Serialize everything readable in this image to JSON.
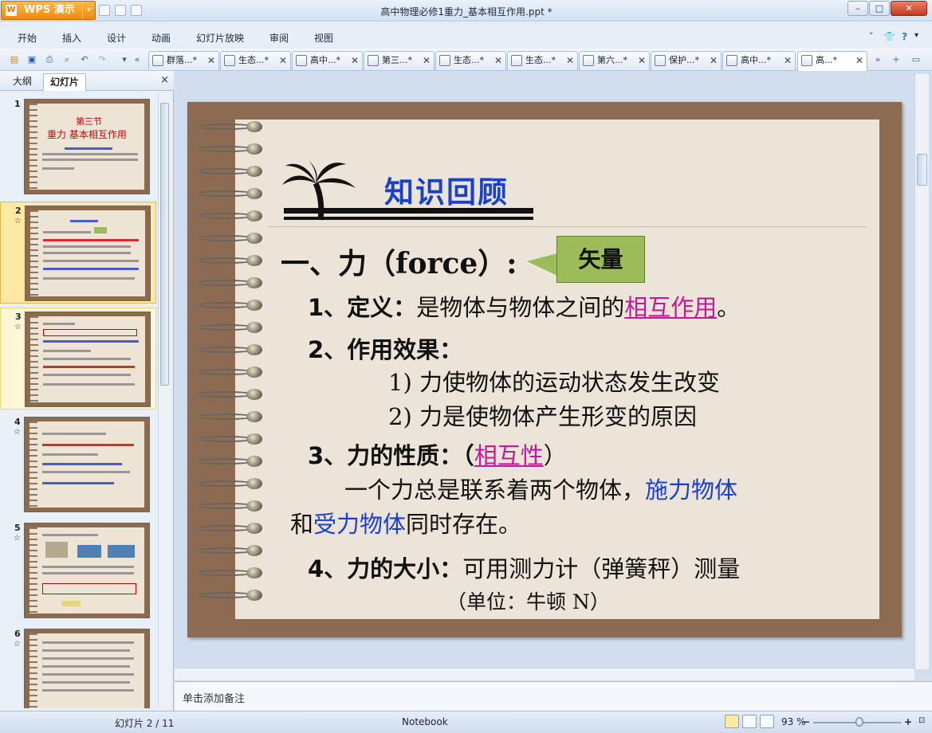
{
  "app": {
    "brand": "WPS 演示",
    "title": "高中物理必修1重力_基本相互作用.ppt *"
  },
  "menu": [
    "开始",
    "插入",
    "设计",
    "动画",
    "幻灯片放映",
    "审阅",
    "视图"
  ],
  "doc_tabs": [
    {
      "label": "群落...*"
    },
    {
      "label": "生态...*"
    },
    {
      "label": "高中...*"
    },
    {
      "label": "第三...*"
    },
    {
      "label": "生态...*"
    },
    {
      "label": "生态...*"
    },
    {
      "label": "第六...*"
    },
    {
      "label": "保护...*"
    },
    {
      "label": "高中...*"
    },
    {
      "label": "高...*"
    }
  ],
  "left_panel": {
    "tab_outline": "大纲",
    "tab_slides": "幻灯片",
    "close": "×"
  },
  "thumbnails": [
    {
      "num": "1",
      "star": ""
    },
    {
      "num": "2",
      "star": "☆"
    },
    {
      "num": "3",
      "star": "☆"
    },
    {
      "num": "4",
      "star": "☆"
    },
    {
      "num": "5",
      "star": "☆"
    },
    {
      "num": "6",
      "star": "☆"
    }
  ],
  "thumb1": {
    "line1": "第三节",
    "line2": "重力 基本相互作用"
  },
  "slide": {
    "heading": "知识回顾",
    "section1": "一、力（force）:",
    "callout": "矢量",
    "def_label": "1、定义：",
    "def_text": "是物体与物体之间的",
    "def_highlight": "相互作用",
    "def_end": "。",
    "effect_label": "2、作用效果：",
    "effect_1": "1) 力使物体的运动状态发生改变",
    "effect_2": "2) 力是使物体产生形变的原因",
    "prop_label": "3、力的性质：（",
    "prop_highlight": "相互性",
    "prop_end": "）",
    "prop_line1": "一个力总是联系着两个物体，",
    "prop_line1_blue": "施力物体",
    "prop_line2_a": "和",
    "prop_line2_blue": "受力物体",
    "prop_line2_b": "同时存在。",
    "size_label": "4、力的大小：",
    "size_text": "可用测力计（弹簧秤）测量",
    "unit": "（单位：牛顿 N）"
  },
  "notes": {
    "placeholder": "单击添加备注"
  },
  "status": {
    "slide_pos": "幻灯片 2 / 11",
    "theme": "Notebook",
    "zoom": "93 %"
  },
  "colors": {
    "accent": "#1a42c8",
    "highlight": "#c2189c",
    "callout": "#9cbb59",
    "frame": "#8c6b52"
  }
}
